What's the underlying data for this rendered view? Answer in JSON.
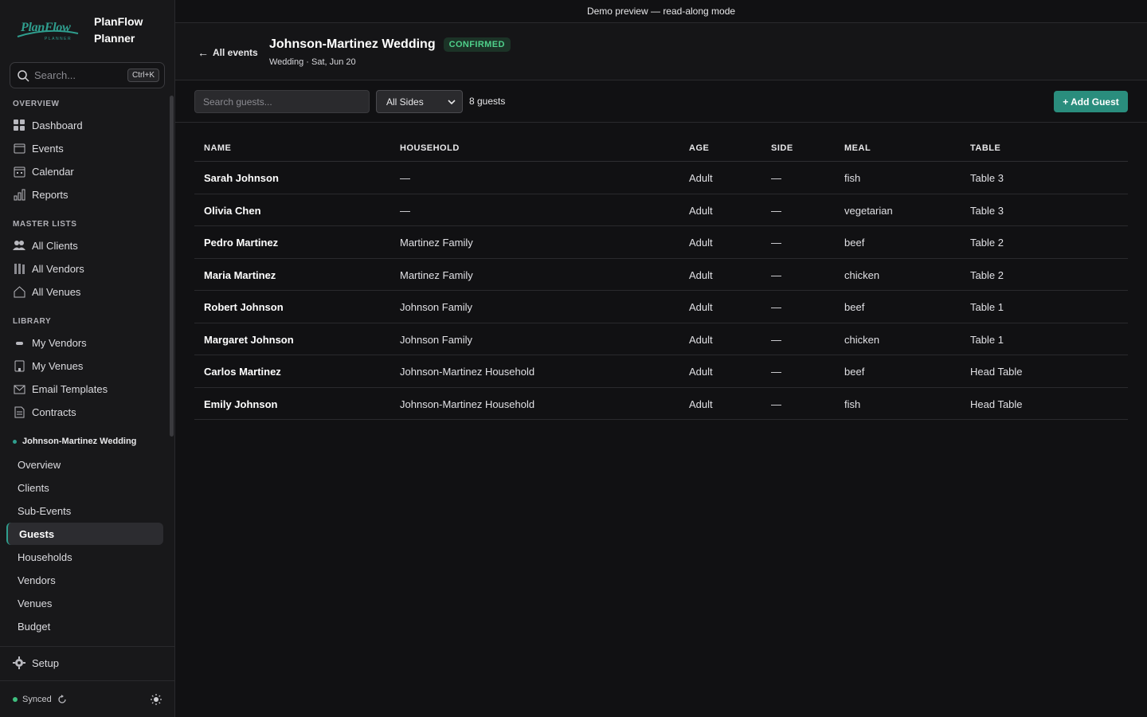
{
  "brand": {
    "name": "PlanFlow Planner",
    "logo_word": "PlanFlow",
    "logo_sub": "PLANNER"
  },
  "search": {
    "placeholder": "Search...",
    "shortcut": "Ctrl+K"
  },
  "sections": {
    "overview": "OVERVIEW",
    "master": "MASTER LISTS",
    "library": "LIBRARY"
  },
  "nav": {
    "overview": [
      "Dashboard",
      "Events",
      "Calendar",
      "Reports"
    ],
    "master": [
      "All Clients",
      "All Vendors",
      "All Venues"
    ],
    "library": [
      "My Vendors",
      "My Venues",
      "Email Templates",
      "Contracts"
    ]
  },
  "current_event": {
    "label": "Johnson-Martinez Wedding",
    "items": [
      "Overview",
      "Clients",
      "Sub-Events",
      "Guests",
      "Households",
      "Vendors",
      "Venues",
      "Budget"
    ],
    "active": "Guests"
  },
  "footer": {
    "setup": "Setup",
    "status": "Synced"
  },
  "topbar": {
    "message": "Demo preview — read-along mode"
  },
  "header": {
    "back": "All events",
    "title": "Johnson-Martinez Wedding",
    "status": "CONFIRMED",
    "subtitle": "Wedding · Sat, Jun 20"
  },
  "toolbar": {
    "search_placeholder": "Search guests...",
    "filter_value": "All Sides",
    "count": "8 guests",
    "add_label": "+ Add Guest"
  },
  "table": {
    "columns": [
      "NAME",
      "HOUSEHOLD",
      "AGE",
      "SIDE",
      "MEAL",
      "TABLE"
    ],
    "rows": [
      {
        "name": "Sarah Johnson",
        "household": "—",
        "age": "Adult",
        "side": "—",
        "meal": "fish",
        "table": "Table 3"
      },
      {
        "name": "Olivia Chen",
        "household": "—",
        "age": "Adult",
        "side": "—",
        "meal": "vegetarian",
        "table": "Table 3"
      },
      {
        "name": "Pedro Martinez",
        "household": "Martinez Family",
        "age": "Adult",
        "side": "—",
        "meal": "beef",
        "table": "Table 2"
      },
      {
        "name": "Maria Martinez",
        "household": "Martinez Family",
        "age": "Adult",
        "side": "—",
        "meal": "chicken",
        "table": "Table 2"
      },
      {
        "name": "Robert Johnson",
        "household": "Johnson Family",
        "age": "Adult",
        "side": "—",
        "meal": "beef",
        "table": "Table 1"
      },
      {
        "name": "Margaret Johnson",
        "household": "Johnson Family",
        "age": "Adult",
        "side": "—",
        "meal": "chicken",
        "table": "Table 1"
      },
      {
        "name": "Carlos Martinez",
        "household": "Johnson-Martinez Household",
        "age": "Adult",
        "side": "—",
        "meal": "beef",
        "table": "Head Table"
      },
      {
        "name": "Emily Johnson",
        "household": "Johnson-Martinez Household",
        "age": "Adult",
        "side": "—",
        "meal": "fish",
        "table": "Head Table"
      }
    ]
  },
  "colors": {
    "accent": "#2f9e8e",
    "badge_text": "#4fd18b",
    "background": "#111113",
    "sidebar": "#18181a"
  }
}
